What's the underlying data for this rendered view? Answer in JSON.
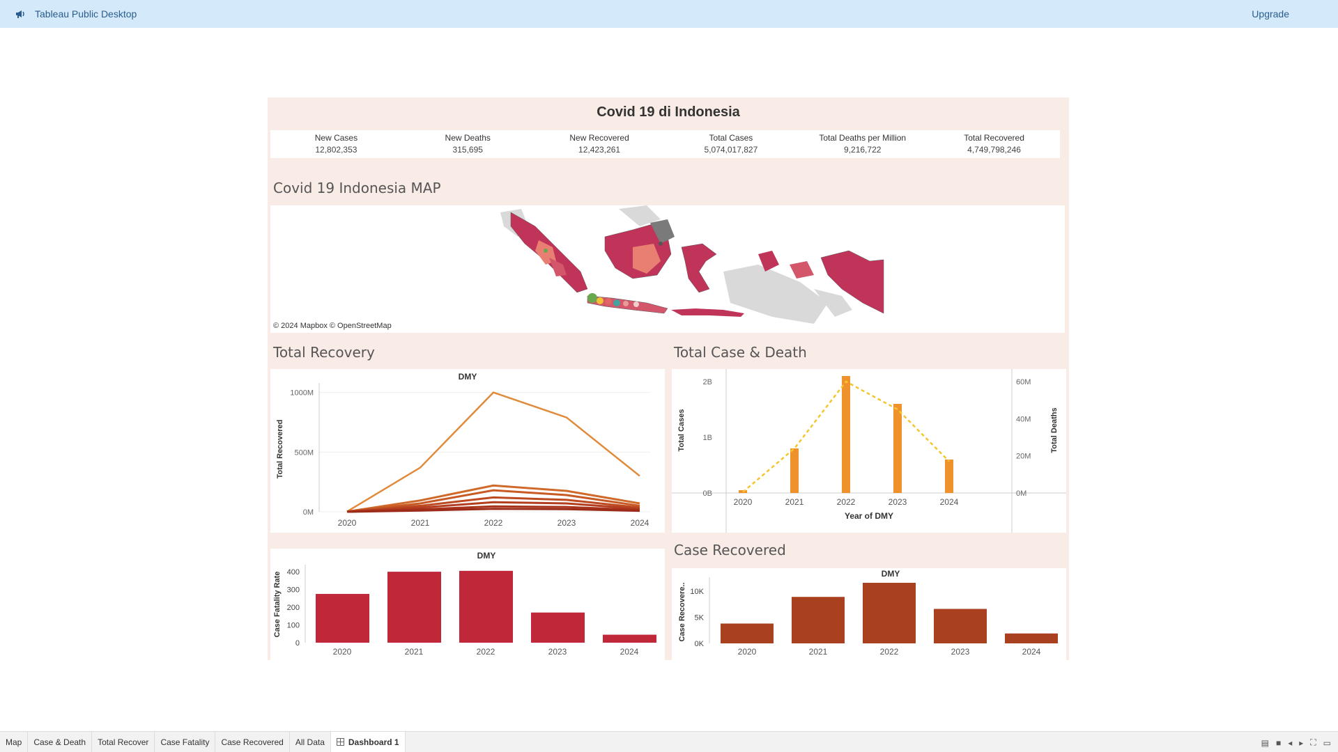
{
  "app": {
    "title": "Tableau Public Desktop",
    "upgrade": "Upgrade"
  },
  "dashboard": {
    "title": "Covid 19 di Indonesia",
    "kpis": [
      {
        "label": "New Cases",
        "value": "12,802,353"
      },
      {
        "label": "New Deaths",
        "value": "315,695"
      },
      {
        "label": "New Recovered",
        "value": "12,423,261"
      },
      {
        "label": "Total Cases",
        "value": "5,074,017,827"
      },
      {
        "label": "Total Deaths per Million",
        "value": "9,216,722"
      },
      {
        "label": "Total Recovered",
        "value": "4,749,798,246"
      }
    ],
    "map": {
      "title": "Covid 19 Indonesia MAP",
      "credit": "© 2024 Mapbox © OpenStreetMap"
    },
    "recovery_title": "Total Recovery",
    "case_death_title": "Total Case & Death",
    "case_recovered_title": "Case Recovered"
  },
  "chart_data": [
    {
      "id": "total-recovery",
      "type": "line",
      "title": "DMY",
      "ylabel": "Total Recovered",
      "x": [
        "2020",
        "2021",
        "2022",
        "2023",
        "2024"
      ],
      "yticks": [
        "0M",
        "500M",
        "1000M"
      ],
      "ylim": [
        0,
        1050
      ],
      "series": [
        {
          "values": [
            2,
            370,
            1000,
            790,
            300
          ],
          "color": "#e08a3a"
        },
        {
          "values": [
            1,
            95,
            220,
            175,
            70
          ],
          "color": "#d06a2a"
        },
        {
          "values": [
            1,
            70,
            180,
            140,
            50
          ],
          "color": "#c85a25"
        },
        {
          "values": [
            1,
            50,
            120,
            100,
            35
          ],
          "color": "#be4a22"
        },
        {
          "values": [
            1,
            35,
            80,
            70,
            25
          ],
          "color": "#b33e20"
        },
        {
          "values": [
            0,
            20,
            45,
            40,
            15
          ],
          "color": "#a8331c"
        },
        {
          "values": [
            0,
            10,
            25,
            22,
            8
          ],
          "color": "#9c2c19"
        }
      ]
    },
    {
      "id": "total-case-death",
      "type": "bar",
      "xlabel": "Year of DMY",
      "ylabel": "Total Cases",
      "y2label": "Total Deaths",
      "categories": [
        "2020",
        "2021",
        "2022",
        "2023",
        "2024"
      ],
      "yticks": [
        "0B",
        "1B",
        "2B"
      ],
      "y2ticks": [
        "0M",
        "20M",
        "40M",
        "60M"
      ],
      "ylim": [
        0,
        2.1
      ],
      "y2lim": [
        0,
        63
      ],
      "bars": [
        0.05,
        0.8,
        2.1,
        1.6,
        0.6
      ],
      "line": [
        0.5,
        24,
        60,
        45,
        17
      ],
      "bar_color": "#f0922b",
      "line_color": "#f5c530"
    },
    {
      "id": "case-fatality",
      "type": "bar",
      "title": "DMY",
      "ylabel": "Case Fatality Rate",
      "categories": [
        "2020",
        "2021",
        "2022",
        "2023",
        "2024"
      ],
      "yticks": [
        "0",
        "100",
        "200",
        "300",
        "400"
      ],
      "ylim": [
        0,
        420
      ],
      "values": [
        275,
        400,
        405,
        170,
        45
      ],
      "color": "#c0283a"
    },
    {
      "id": "case-recovered",
      "type": "bar",
      "title": "DMY",
      "ylabel": "Case Recovere..",
      "categories": [
        "2020",
        "2021",
        "2022",
        "2023",
        "2024"
      ],
      "yticks": [
        "0K",
        "5K",
        "10K"
      ],
      "ylim": [
        0,
        12000
      ],
      "values": [
        3800,
        8900,
        11600,
        6600,
        1900
      ],
      "color": "#a9401f"
    }
  ],
  "tabs": [
    {
      "label": "Map",
      "active": false
    },
    {
      "label": "Case & Death",
      "active": false
    },
    {
      "label": "Total Recover",
      "active": false
    },
    {
      "label": "Case Fatality",
      "active": false
    },
    {
      "label": "Case Recovered",
      "active": false
    },
    {
      "label": "All Data",
      "active": false
    },
    {
      "label": "Dashboard 1",
      "active": true
    }
  ]
}
